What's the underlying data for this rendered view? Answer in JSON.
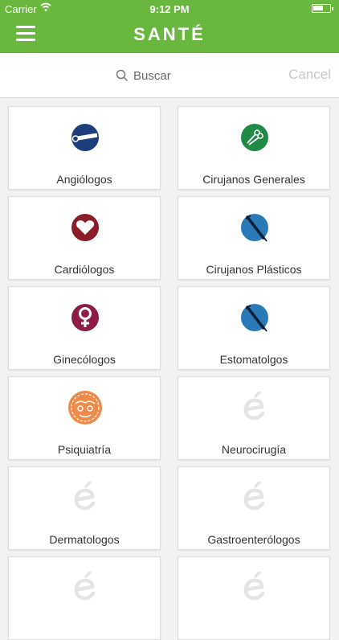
{
  "status": {
    "carrier": "Carrier",
    "time": "9:12 PM"
  },
  "header": {
    "logo": "SANTÉ",
    "menu_icon": "hamburger-menu-icon"
  },
  "search": {
    "placeholder": "Buscar",
    "cancel_label": "Cancel"
  },
  "colors": {
    "brand": "#6ab73f"
  },
  "specialties": [
    {
      "label": "Angiólogos",
      "icon": "vein-icon"
    },
    {
      "label": "Cirujanos Generales",
      "icon": "scissors-icon"
    },
    {
      "label": "Cardiólogos",
      "icon": "heart-icon"
    },
    {
      "label": "Cirujanos Plásticos",
      "icon": "syringe-icon"
    },
    {
      "label": "Ginecólogos",
      "icon": "female-icon"
    },
    {
      "label": "Estomatolgos",
      "icon": "syringe-icon"
    },
    {
      "label": "Psiquiatría",
      "icon": "brain-icon"
    },
    {
      "label": "Neurocirugía",
      "icon": "sante-placeholder-icon"
    },
    {
      "label": "Dermatologos",
      "icon": "sante-placeholder-icon"
    },
    {
      "label": "Gastroenterólogos",
      "icon": "sante-placeholder-icon"
    },
    {
      "label": "",
      "icon": "sante-placeholder-icon"
    },
    {
      "label": "",
      "icon": "sante-placeholder-icon"
    }
  ]
}
